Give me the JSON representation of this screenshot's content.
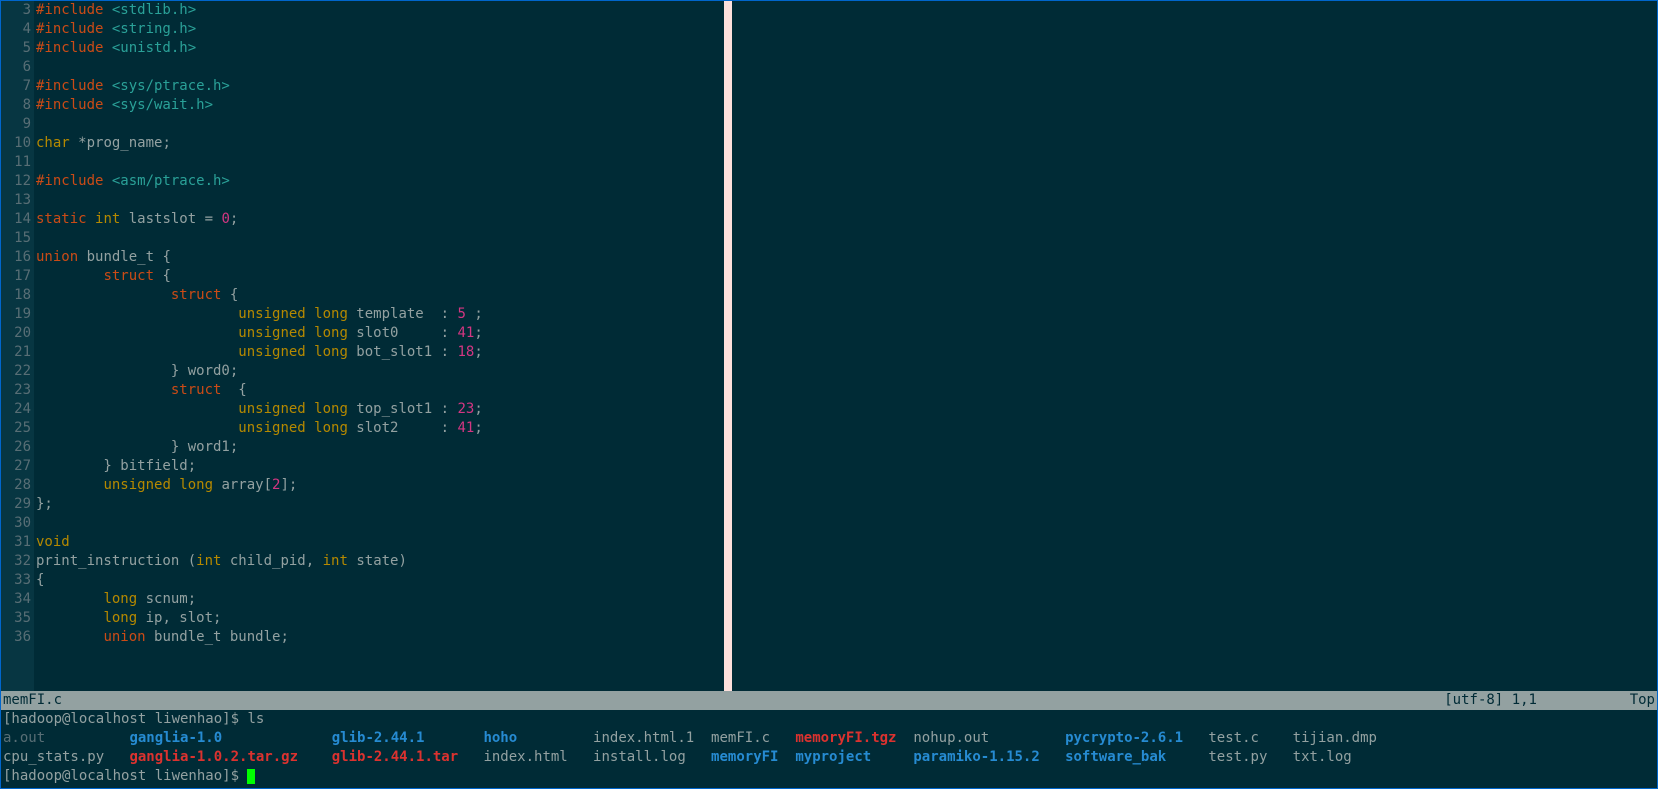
{
  "status": {
    "filename": "memFI.c",
    "encoding": "[utf-8]",
    "pos": "1,1",
    "scroll": "Top"
  },
  "code_lines": [
    {
      "n": 3,
      "tokens": [
        [
          "kw-pre",
          "#include "
        ],
        [
          "hdr",
          "<stdlib.h>"
        ]
      ]
    },
    {
      "n": 4,
      "tokens": [
        [
          "kw-pre",
          "#include "
        ],
        [
          "hdr",
          "<string.h>"
        ]
      ]
    },
    {
      "n": 5,
      "tokens": [
        [
          "kw-pre",
          "#include "
        ],
        [
          "hdr",
          "<unistd.h>"
        ]
      ]
    },
    {
      "n": 6,
      "tokens": []
    },
    {
      "n": 7,
      "tokens": [
        [
          "kw-pre",
          "#include "
        ],
        [
          "hdr",
          "<sys/ptrace.h>"
        ]
      ]
    },
    {
      "n": 8,
      "tokens": [
        [
          "kw-pre",
          "#include "
        ],
        [
          "hdr",
          "<sys/wait.h>"
        ]
      ]
    },
    {
      "n": 9,
      "tokens": []
    },
    {
      "n": 10,
      "tokens": [
        [
          "kw-type",
          "char "
        ],
        [
          "ident",
          "*prog_name;"
        ]
      ]
    },
    {
      "n": 11,
      "tokens": []
    },
    {
      "n": 12,
      "tokens": [
        [
          "kw-pre",
          "#include "
        ],
        [
          "hdr",
          "<asm/ptrace.h>"
        ]
      ]
    },
    {
      "n": 13,
      "tokens": []
    },
    {
      "n": 14,
      "tokens": [
        [
          "kw-pre",
          "static "
        ],
        [
          "kw-type",
          "int "
        ],
        [
          "ident",
          "lastslot = "
        ],
        [
          "num",
          "0"
        ],
        [
          "ident",
          ";"
        ]
      ]
    },
    {
      "n": 15,
      "tokens": []
    },
    {
      "n": 16,
      "tokens": [
        [
          "kw-pre",
          "union"
        ],
        [
          "ident",
          " bundle_t {"
        ]
      ]
    },
    {
      "n": 17,
      "tokens": [
        [
          "ident",
          "        "
        ],
        [
          "kw-pre",
          "struct"
        ],
        [
          "ident",
          " {"
        ]
      ]
    },
    {
      "n": 18,
      "tokens": [
        [
          "ident",
          "                "
        ],
        [
          "kw-pre",
          "struct"
        ],
        [
          "ident",
          " {"
        ]
      ]
    },
    {
      "n": 19,
      "tokens": [
        [
          "ident",
          "                        "
        ],
        [
          "kw-type",
          "unsigned long"
        ],
        [
          "ident",
          " template  : "
        ],
        [
          "num",
          "5"
        ],
        [
          "ident",
          " ;"
        ]
      ]
    },
    {
      "n": 20,
      "tokens": [
        [
          "ident",
          "                        "
        ],
        [
          "kw-type",
          "unsigned long"
        ],
        [
          "ident",
          " slot0     : "
        ],
        [
          "num",
          "41"
        ],
        [
          "ident",
          ";"
        ]
      ]
    },
    {
      "n": 21,
      "tokens": [
        [
          "ident",
          "                        "
        ],
        [
          "kw-type",
          "unsigned long"
        ],
        [
          "ident",
          " bot_slot1 : "
        ],
        [
          "num",
          "18"
        ],
        [
          "ident",
          ";"
        ]
      ]
    },
    {
      "n": 22,
      "tokens": [
        [
          "ident",
          "                } word0;"
        ]
      ]
    },
    {
      "n": 23,
      "tokens": [
        [
          "ident",
          "                "
        ],
        [
          "kw-pre",
          "struct"
        ],
        [
          "ident",
          "  {"
        ]
      ]
    },
    {
      "n": 24,
      "tokens": [
        [
          "ident",
          "                        "
        ],
        [
          "kw-type",
          "unsigned long"
        ],
        [
          "ident",
          " top_slot1 : "
        ],
        [
          "num",
          "23"
        ],
        [
          "ident",
          ";"
        ]
      ]
    },
    {
      "n": 25,
      "tokens": [
        [
          "ident",
          "                        "
        ],
        [
          "kw-type",
          "unsigned long"
        ],
        [
          "ident",
          " slot2     : "
        ],
        [
          "num",
          "41"
        ],
        [
          "ident",
          ";"
        ]
      ]
    },
    {
      "n": 26,
      "tokens": [
        [
          "ident",
          "                } word1;"
        ]
      ]
    },
    {
      "n": 27,
      "tokens": [
        [
          "ident",
          "        } bitfield;"
        ]
      ]
    },
    {
      "n": 28,
      "tokens": [
        [
          "ident",
          "        "
        ],
        [
          "kw-type",
          "unsigned long"
        ],
        [
          "ident",
          " array["
        ],
        [
          "num",
          "2"
        ],
        [
          "ident",
          "];"
        ]
      ]
    },
    {
      "n": 29,
      "tokens": [
        [
          "ident",
          "};"
        ]
      ]
    },
    {
      "n": 30,
      "tokens": []
    },
    {
      "n": 31,
      "tokens": [
        [
          "kw-type",
          "void"
        ]
      ]
    },
    {
      "n": 32,
      "tokens": [
        [
          "ident",
          "print_instruction ("
        ],
        [
          "kw-type",
          "int"
        ],
        [
          "ident",
          " child_pid, "
        ],
        [
          "kw-type",
          "int"
        ],
        [
          "ident",
          " state)"
        ]
      ]
    },
    {
      "n": 33,
      "tokens": [
        [
          "ident",
          "{"
        ]
      ]
    },
    {
      "n": 34,
      "tokens": [
        [
          "ident",
          "        "
        ],
        [
          "kw-type",
          "long"
        ],
        [
          "ident",
          " scnum;"
        ]
      ]
    },
    {
      "n": 35,
      "tokens": [
        [
          "ident",
          "        "
        ],
        [
          "kw-type",
          "long"
        ],
        [
          "ident",
          " ip, slot;"
        ]
      ]
    },
    {
      "n": 36,
      "tokens": [
        [
          "ident",
          "        "
        ],
        [
          "kw-pre",
          "union"
        ],
        [
          "ident",
          " bundle_t bundle;"
        ]
      ]
    }
  ],
  "term": {
    "prompt1": "[hadoop@localhost liwenhao]$ ",
    "cmd1": "ls",
    "prompt2": "[hadoop@localhost liwenhao]$ ",
    "ls_rows": [
      [
        {
          "cls": "f-dim",
          "txt": "a.out",
          "w": 15
        },
        {
          "cls": "f-blue",
          "txt": "ganglia-1.0",
          "w": 24
        },
        {
          "cls": "f-blue",
          "txt": "glib-2.44.1",
          "w": 18
        },
        {
          "cls": "f-blue",
          "txt": "hoho",
          "w": 13
        },
        {
          "cls": "f-norm",
          "txt": "index.html.1",
          "w": 14
        },
        {
          "cls": "f-norm",
          "txt": "memFI.c",
          "w": 10
        },
        {
          "cls": "f-red",
          "txt": "memoryFI.tgz",
          "w": 14
        },
        {
          "cls": "f-norm",
          "txt": "nohup.out",
          "w": 18
        },
        {
          "cls": "f-blue",
          "txt": "pycrypto-2.6.1",
          "w": 17
        },
        {
          "cls": "f-norm",
          "txt": "test.c",
          "w": 10
        },
        {
          "cls": "f-norm",
          "txt": "tijian.dmp",
          "w": 0
        }
      ],
      [
        {
          "cls": "f-norm",
          "txt": "cpu_stats.py",
          "w": 15
        },
        {
          "cls": "f-red",
          "txt": "ganglia-1.0.2.tar.gz",
          "w": 24
        },
        {
          "cls": "f-red",
          "txt": "glib-2.44.1.tar",
          "w": 18
        },
        {
          "cls": "f-norm",
          "txt": "index.html",
          "w": 13
        },
        {
          "cls": "f-norm",
          "txt": "install.log",
          "w": 14
        },
        {
          "cls": "f-blue",
          "txt": "memoryFI",
          "w": 10
        },
        {
          "cls": "f-blue",
          "txt": "myproject",
          "w": 14
        },
        {
          "cls": "f-blue",
          "txt": "paramiko-1.15.2",
          "w": 18
        },
        {
          "cls": "f-blue",
          "txt": "software_bak",
          "w": 17
        },
        {
          "cls": "f-norm",
          "txt": "test.py",
          "w": 10
        },
        {
          "cls": "f-norm",
          "txt": "txt.log",
          "w": 0
        }
      ]
    ]
  }
}
